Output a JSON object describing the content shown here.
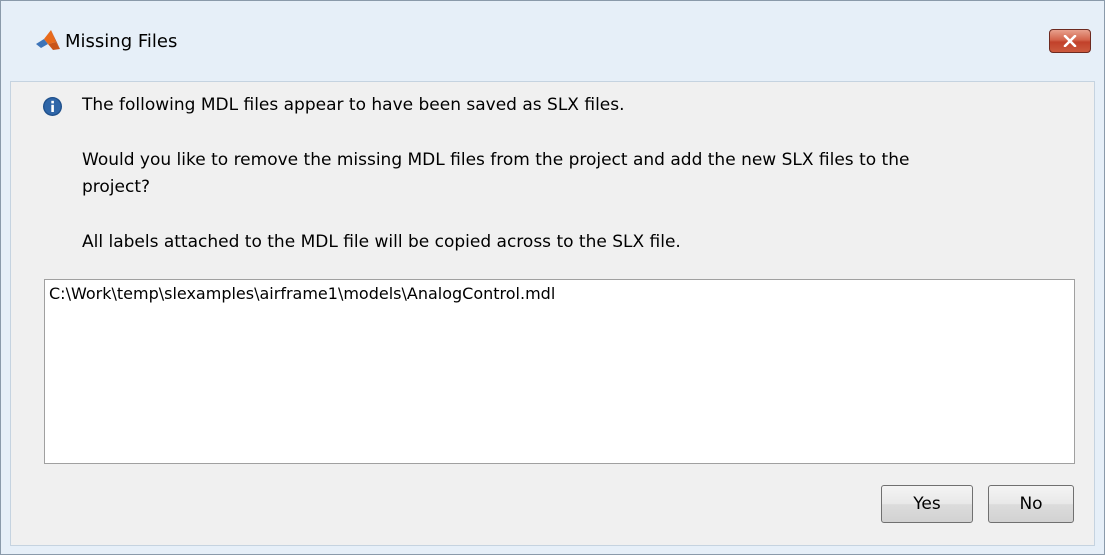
{
  "window": {
    "title": "Missing Files"
  },
  "message": {
    "line1": "The following MDL files appear to have been saved as SLX files.",
    "line2": "Would you like to remove the missing MDL files from the project and add the new SLX files to the",
    "line3": "project?",
    "line4": "All labels attached to the MDL file will be copied across to the SLX file."
  },
  "file_list": {
    "items": [
      "C:\\Work\\temp\\slexamples\\airframe1\\models\\AnalogControl.mdl"
    ]
  },
  "buttons": {
    "yes_label": "Yes",
    "no_label": "No"
  },
  "icons": {
    "app": "matlab-logo-icon",
    "info": "info-icon",
    "close": "close-icon"
  },
  "colors": {
    "frame": "#e6eff8",
    "close_button": "#c7452d",
    "info_icon": "#1e4f8a",
    "matlab_orange": "#e86a1c"
  }
}
